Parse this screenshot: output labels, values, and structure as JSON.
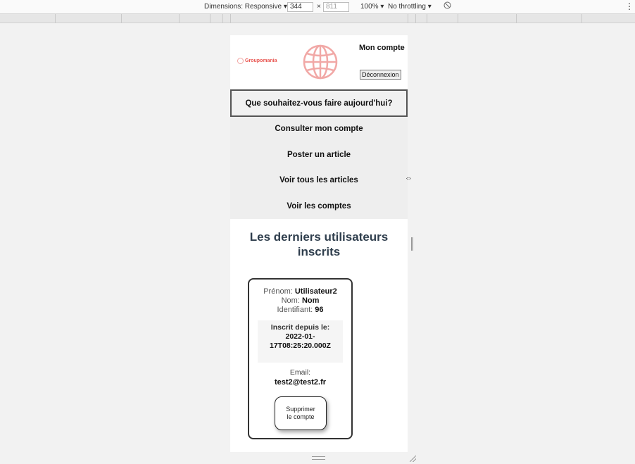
{
  "devtools": {
    "dimensions_label": "Dimensions: Responsive ▾",
    "width": "344",
    "times": "×",
    "height": "811",
    "zoom": "100% ▾",
    "throttling": "No throttling ▾",
    "rotate_icon": "⃠",
    "menu_icon": "⋮"
  },
  "header": {
    "brand": "Groupomania",
    "account": "Mon compte",
    "logout": "Déconnexion"
  },
  "nav": {
    "question": "Que souhaitez-vous faire aujourd'hui?",
    "items": [
      "Consulter mon compte",
      "Poster un article",
      "Voir tous les articles",
      "Voir les comptes"
    ]
  },
  "section": {
    "title_line1": "Les derniers utilisateurs",
    "title_line2": "inscrits"
  },
  "user_card": {
    "prenom_label": "Prénom:",
    "prenom": "Utilisateur2",
    "nom_label": "Nom:",
    "nom": "Nom",
    "id_label": "Identifiant:",
    "id": "96",
    "since_label": "Inscrit depuis le:",
    "since_line1": "2022-01-",
    "since_line2": "17T08:25:20.000Z",
    "email_label": "Email:",
    "email": "test2@test2.fr",
    "delete_line1": "Supprimer",
    "delete_line2": "le compte"
  },
  "colors": {
    "brand": "#e8544f",
    "title": "#2f3e4d"
  }
}
